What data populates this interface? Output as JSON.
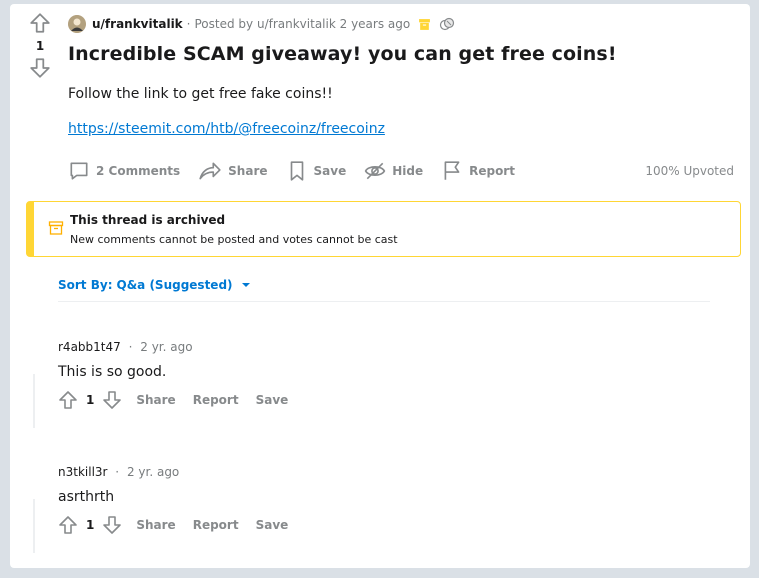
{
  "post": {
    "vote_count": "1",
    "author": "u/frankvitalik",
    "posted_by_prefix": "Posted by",
    "posted_by_user": "u/frankvitalik",
    "time_ago": "2 years ago",
    "title": "Incredible SCAM giveaway! you can get free coins!",
    "body": "Follow the link to get free fake coins!!",
    "link": "https://steemit.com/htb/@freecoinz/freecoinz",
    "actions": {
      "comments": "2 Comments",
      "share": "Share",
      "save": "Save",
      "hide": "Hide",
      "report": "Report"
    },
    "upvoted": "100% Upvoted"
  },
  "archived": {
    "title": "This thread is archived",
    "text": "New comments cannot be posted and votes cannot be cast"
  },
  "sort": {
    "label": "Sort By:",
    "value": "Q&a (Suggested)"
  },
  "comments": [
    {
      "user": "r4abb1t47",
      "sep": "·",
      "time": "2 yr. ago",
      "body": "This is so good.",
      "votes": "1",
      "share": "Share",
      "report": "Report",
      "save": "Save"
    },
    {
      "user": "n3tkill3r",
      "sep": "·",
      "time": "2 yr. ago",
      "body": "asrthrth",
      "votes": "1",
      "share": "Share",
      "report": "Report",
      "save": "Save"
    }
  ],
  "colors": {
    "accent_link": "#0079d3",
    "archived_border": "#ffd635",
    "muted_text": "#878a8c",
    "background": "#dae0e6"
  }
}
